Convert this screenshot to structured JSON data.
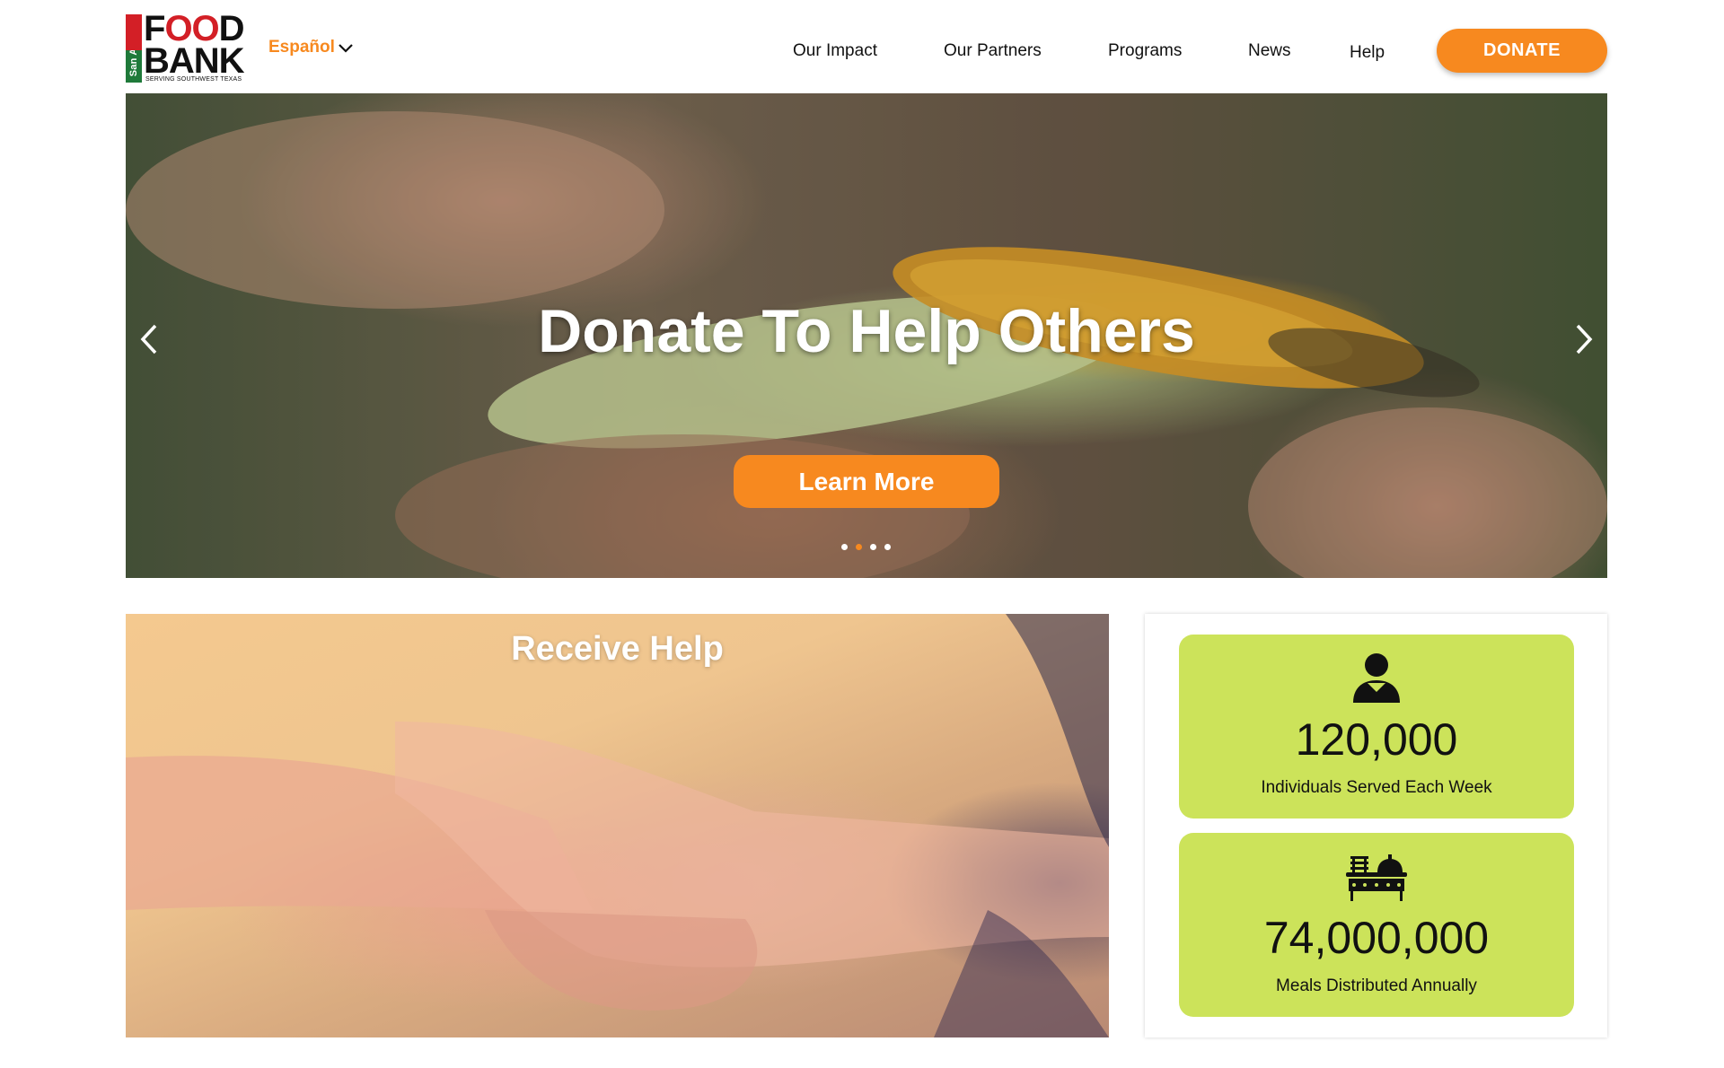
{
  "header": {
    "logo": {
      "side_text": "San Antonio",
      "word_food_start": "F",
      "word_food_mid": "OO",
      "word_food_end": "D",
      "word_bank": "BANK",
      "tagline": "SERVING SOUTHWEST TEXAS"
    },
    "language": {
      "label": "Español",
      "icon": "chevron-down-icon"
    },
    "nav": [
      "Our Impact",
      "Our Partners",
      "Programs",
      "News",
      "Help"
    ],
    "donate_label": "DONATE"
  },
  "hero": {
    "title": "Donate To Help Others",
    "button_label": "Learn More",
    "prev_icon": "chevron-left-icon",
    "next_icon": "chevron-right-icon",
    "slides_count": 4,
    "active_slide": 2
  },
  "receive_help": {
    "title": "Receive Help"
  },
  "stats": [
    {
      "icon": "person-icon",
      "value": "120,000",
      "label": "Individuals Served Each Week"
    },
    {
      "icon": "food-cart-icon",
      "value": "74,000,000",
      "label": "Meals Distributed Annually"
    }
  ],
  "colors": {
    "accent": "#f7891f",
    "stat_card": "#cce35a",
    "logo_red": "#d31f26",
    "logo_green": "#1f7a3a"
  }
}
